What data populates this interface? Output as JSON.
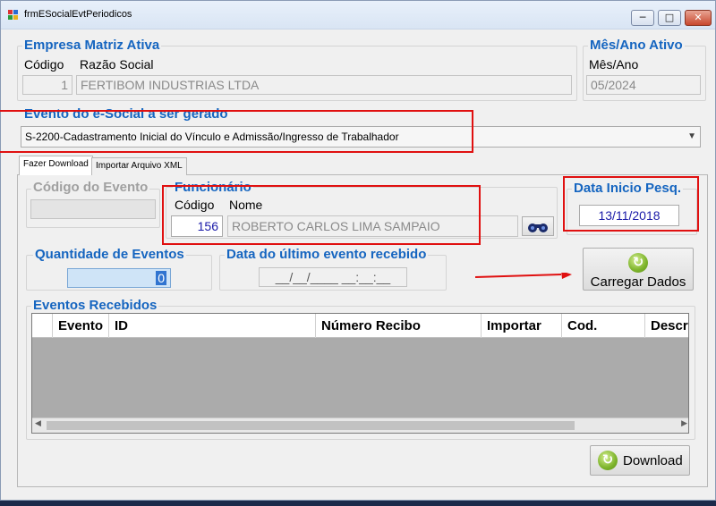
{
  "window": {
    "title": "frmESocialEvtPeriodicos",
    "minimize_glyph": "─",
    "maximize_glyph": "□",
    "close_glyph": "✕"
  },
  "empresa": {
    "legend": "Empresa Matriz Ativa",
    "codigo_label": "Código",
    "razao_label": "Razão Social",
    "codigo_value": "1",
    "razao_value": "FERTIBOM INDUSTRIAS LTDA"
  },
  "mesano": {
    "legend": "Mês/Ano Ativo",
    "label": "Mês/Ano",
    "value": "05/2024"
  },
  "evento": {
    "legend": "Evento do e-Social a ser gerado",
    "selected": "S-2200-Cadastramento Inicial do Vínculo e Admissão/Ingresso de Trabalhador"
  },
  "tabs": [
    {
      "label": "Fazer Download"
    },
    {
      "label": "Importar Arquivo XML"
    }
  ],
  "codigo_evento": {
    "legend": "Código do Evento",
    "value": ""
  },
  "funcionario": {
    "legend": "Funcionário",
    "codigo_label": "Código",
    "nome_label": "Nome",
    "codigo_value": "156",
    "nome_value": "ROBERTO CARLOS LIMA SAMPAIO"
  },
  "data_inicio": {
    "legend": "Data Inicio Pesq.",
    "value": "13/11/2018"
  },
  "quantidade": {
    "legend": "Quantidade de Eventos",
    "value": "0"
  },
  "ultimo_evento": {
    "legend": "Data do último evento recebido",
    "value": "__/__/____ __:__:__"
  },
  "carregar": {
    "label": "Carregar Dados"
  },
  "eventos": {
    "legend": "Eventos Recebidos",
    "columns": [
      "Evento",
      "ID",
      "Número Recibo",
      "Importar",
      "Cod.",
      "Descr"
    ],
    "rows": []
  },
  "download": {
    "label": "Download"
  },
  "colors": {
    "legend_blue": "#1565c0",
    "highlight_red": "#e01010",
    "value_blue": "#1a1aa8"
  }
}
